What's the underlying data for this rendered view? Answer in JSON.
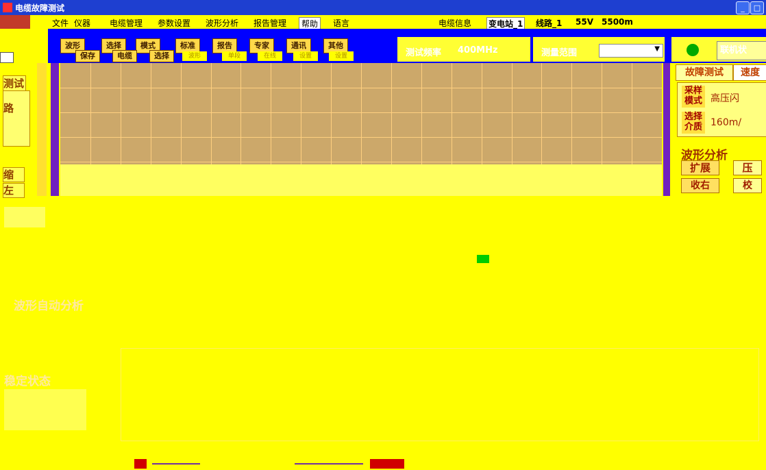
{
  "window": {
    "title": "电缆故障测试"
  },
  "menu": {
    "items": [
      "文件",
      "仪器",
      "电缆管理",
      "参数设置",
      "波形分析",
      "报告管理",
      "帮助",
      "语言"
    ],
    "cable_info_label": "电缆信息",
    "station": "变电站_1",
    "line": "线路_1",
    "voltage": "55V",
    "length": "5500m"
  },
  "toolbar": {
    "top_row": [
      "波形",
      "选择",
      "模式",
      "标准",
      "报告",
      "专家",
      "通讯",
      "其他"
    ],
    "bottom_row": [
      "保存",
      "电缆",
      "选择",
      "波形",
      "单段",
      "在线",
      "设置",
      "设置"
    ],
    "test_freq_label": "测试频率",
    "test_freq_value": "400MHz",
    "range_label": "测量范围",
    "connect_label": "联机状"
  },
  "left_panel": {
    "tab_test": "测试",
    "item_circuit": "路",
    "btn_shrink": "缩",
    "btn_shift": "左",
    "auto_analysis": "波形自动分析",
    "stability": "稳定状态"
  },
  "right_panel": {
    "tab_fault": "故障测试",
    "tab_speed": "速度",
    "sample_mode_label": "采样模式",
    "sample_mode_value": "高压闪",
    "medium_label": "选择介质",
    "medium_value": "160m/",
    "wave_analysis": "波形分析",
    "btn_expand": "扩展",
    "btn_compress": "压",
    "btn_move": "收右",
    "btn_move2": "校"
  },
  "colors": {
    "background": "#ffff00",
    "plot": "#cca86a",
    "grid": "#ffd080",
    "toolbar": "#0000ff"
  }
}
